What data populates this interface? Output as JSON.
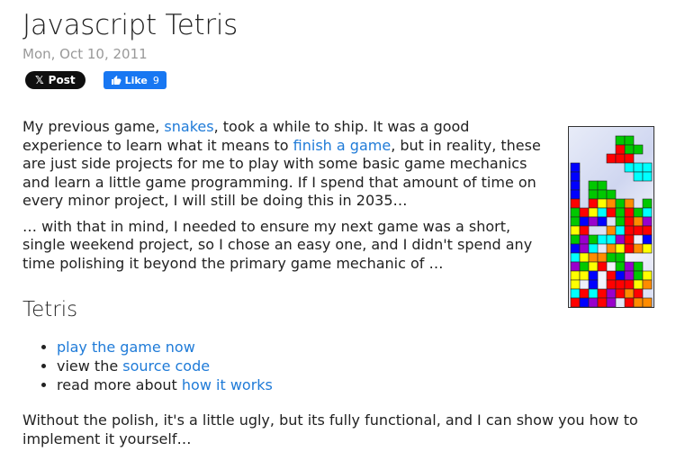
{
  "page": {
    "title": "Javascript Tetris",
    "date": "Mon, Oct 10, 2011"
  },
  "social": {
    "x_label": "Post",
    "fb_label": "Like",
    "fb_count": "9"
  },
  "para1": {
    "t1": "My previous game, ",
    "link1": "snakes",
    "t2": ", took a while to ship. It was a good experience to learn what it means to ",
    "link2": "finish a game",
    "t3": ", but in reality, these are just side projects for me to play with some basic game mechanics and learn a little game programming. If I spend that amount of time on every minor project, I will still be doing this in 2035…"
  },
  "para2": "… with that in mind, I needed to ensure my next game was a short, single weekend project, so I chose an easy one, and I didn't spend any time polishing it beyond the primary game mechanic of …",
  "section_heading": "Tetris",
  "list": [
    {
      "pre": "",
      "link": "play the game now"
    },
    {
      "pre": "view the ",
      "link": "source code"
    },
    {
      "pre": "read more about ",
      "link": "how it works"
    }
  ],
  "final_para": "Without the polish, it's a little ugly, but its fully functional, and I can show you how to implement it yourself…",
  "colors": {
    "link": "#1f7bd8",
    "x_button": "#0f0f0f",
    "fb_button": "#1877f2"
  },
  "icons": {
    "x": "x-logo-icon",
    "fb": "thumbs-up-icon"
  }
}
